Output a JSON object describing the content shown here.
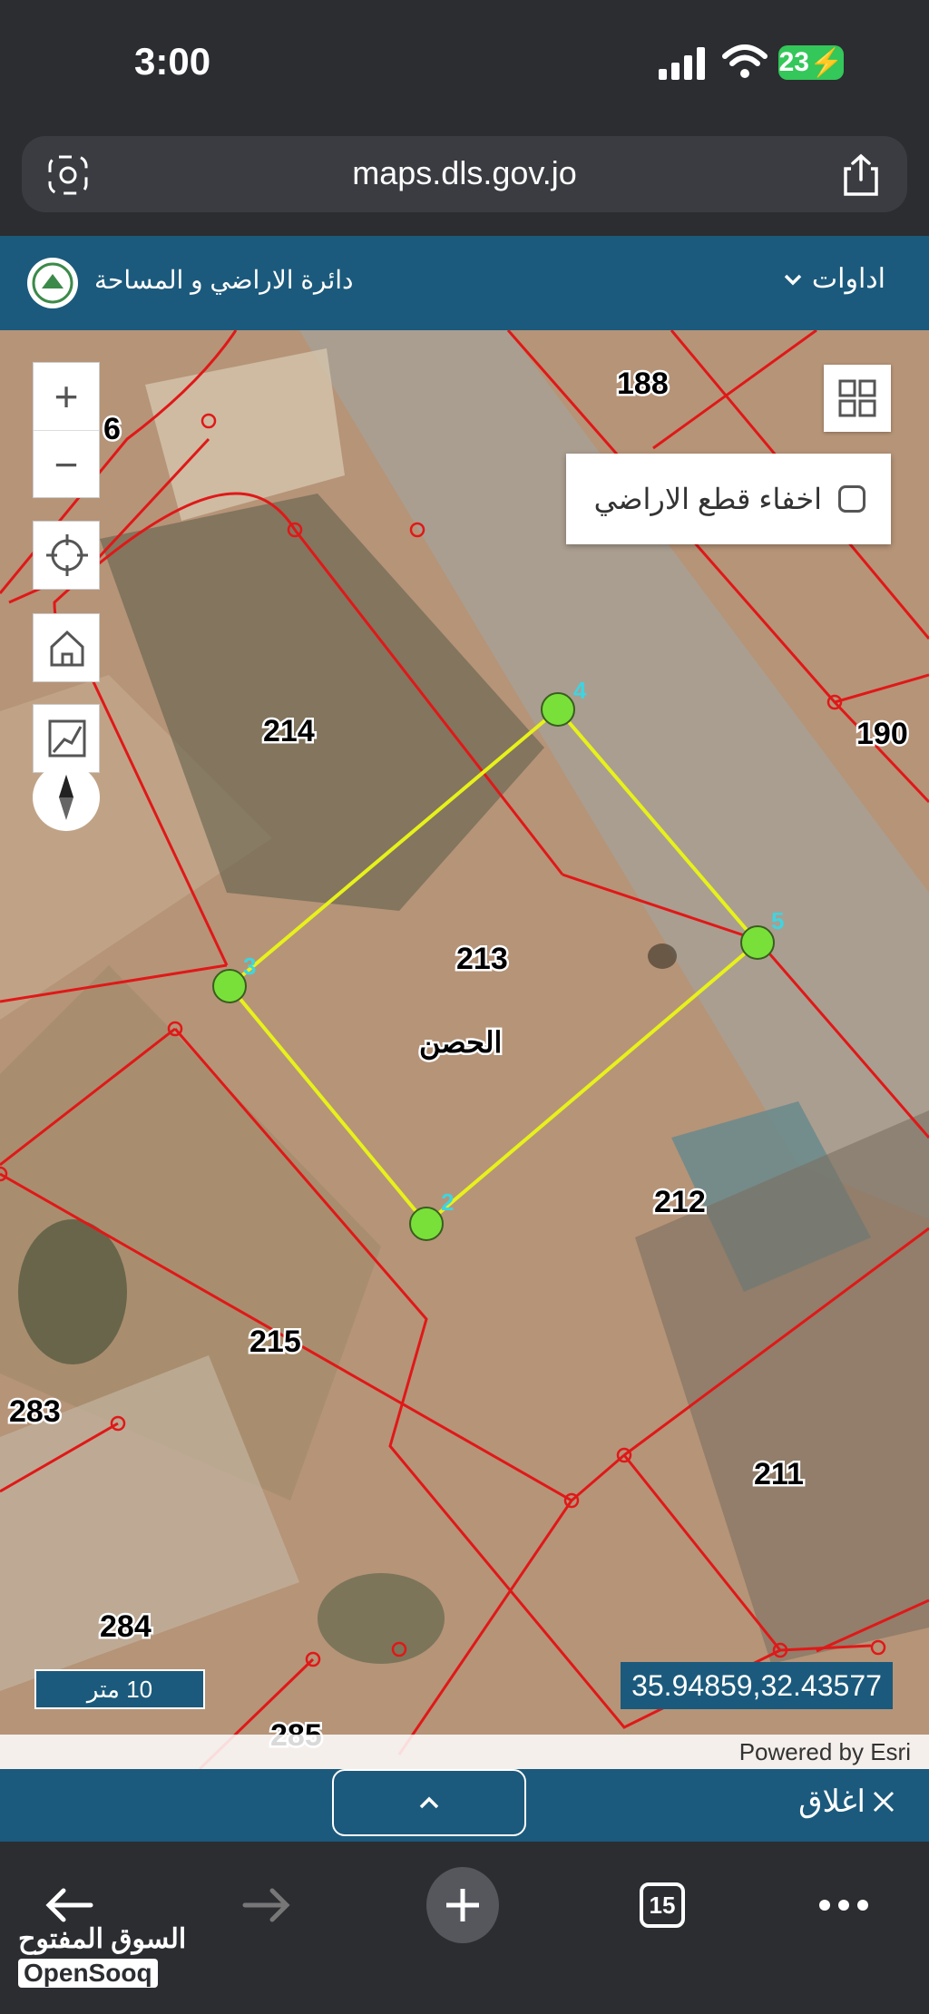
{
  "status_bar": {
    "time": "3:00",
    "battery": "23"
  },
  "browser": {
    "url": "maps.dls.gov.jo",
    "tab_count": "15"
  },
  "header": {
    "title": "دائرة الاراضي و المساحة",
    "tools_label": "اداوات"
  },
  "map": {
    "hide_parcels_label": "اخفاء قطع الاراضي",
    "hide_parcels_checked": false,
    "area_name": "الحصن",
    "parcels": [
      "188",
      "190",
      "214",
      "213",
      "212",
      "211",
      "215",
      "283",
      "284",
      "285",
      "6"
    ],
    "vertices": [
      "4",
      "5",
      "3",
      "2"
    ],
    "scale_label": "10 متر",
    "coordinates": "35.94859,32.43577",
    "attribution": "Powered by Esri"
  },
  "bottom_bar": {
    "close_label": "اغلاق"
  },
  "watermark": {
    "arabic": "السوق المفتوح",
    "english": "OpenSooq"
  },
  "colors": {
    "header": "#1b5a7c",
    "parcel_lines": "#e01818",
    "selection": "#e7f21a",
    "vertex": "#79e03a"
  }
}
